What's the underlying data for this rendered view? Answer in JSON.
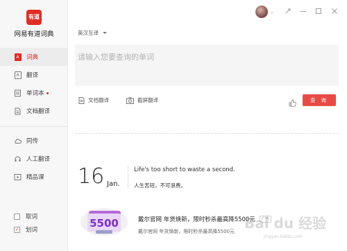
{
  "app": {
    "logo_text": "有道",
    "name": "网易有道词典"
  },
  "sidebar": {
    "items": [
      {
        "label": "词典",
        "icon": "dictionary-icon",
        "active": true
      },
      {
        "label": "翻译",
        "icon": "translate-icon"
      },
      {
        "label": "单词本",
        "icon": "wordbook-icon",
        "dot": true
      },
      {
        "label": "文档翻译",
        "icon": "document-icon"
      },
      {
        "label": "同传",
        "icon": "cloud-icon"
      },
      {
        "label": "人工翻译",
        "icon": "headset-icon"
      },
      {
        "label": "精品课",
        "icon": "play-icon"
      }
    ],
    "options": [
      {
        "label": "取词",
        "checked": false
      },
      {
        "label": "划词",
        "checked": true
      }
    ]
  },
  "titlebar": {
    "icons": [
      "avatar",
      "chevron-down-icon",
      "pin-icon",
      "minimize-icon",
      "maximize-icon",
      "close-icon"
    ]
  },
  "main": {
    "language": "英汉互译",
    "search": {
      "placeholder": "请输入您要查询的单词",
      "value": ""
    },
    "tools": {
      "doc_translate": "文档翻译",
      "screenshot_translate": "截屏翻译"
    },
    "query_button": "查 询",
    "daily": {
      "day": "16",
      "month": "Jan.",
      "quote_en": "Life's too short to waste a second.",
      "quote_cn": "人生苦短，不可浪费。"
    },
    "ad": {
      "image_text": "5500",
      "title": "戴尔官网 年货焕新，限时秒杀最高降5500元",
      "badge": "广告",
      "subtitle": "戴尔官网 年货焕新，限时秒杀最高降5500元"
    },
    "watermark": "Bai du 经验",
    "watermark_url": "jingyan.baidu.com"
  },
  "colors": {
    "accent": "#e02c24",
    "button": "#ea4a44"
  }
}
